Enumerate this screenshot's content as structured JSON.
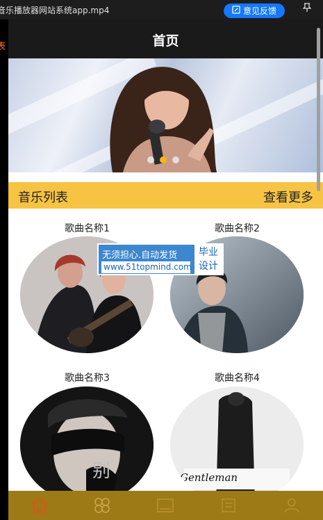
{
  "player": {
    "title": "音乐播放器网站系统app.mp4",
    "feedback_label": "意见反馈",
    "left_edge_text": "表"
  },
  "nav": {
    "title": "首页"
  },
  "banner": {
    "slide_count": 3,
    "active_slide": 2
  },
  "section": {
    "title": "音乐列表",
    "more_label": "查看更多"
  },
  "songs": [
    {
      "name": "歌曲名称1"
    },
    {
      "name": "歌曲名称2"
    },
    {
      "name": "歌曲名称3"
    },
    {
      "name": "歌曲名称4"
    }
  ],
  "watermark": {
    "line1": "无须担心.自动发货",
    "url": "www.51topmind.com",
    "side_top": "毕业",
    "side_bottom": "设计"
  },
  "cover4_text": "Gentleman",
  "tabbar": {
    "icons": [
      "home-icon",
      "apps-icon",
      "image-icon",
      "list-icon",
      "user-icon"
    ],
    "active": "home-icon"
  },
  "colors": {
    "accent": "#f6c343",
    "nav_bg": "#1a1a1a",
    "tab_bg": "#9d7a16",
    "feedback": "#1677ff"
  }
}
